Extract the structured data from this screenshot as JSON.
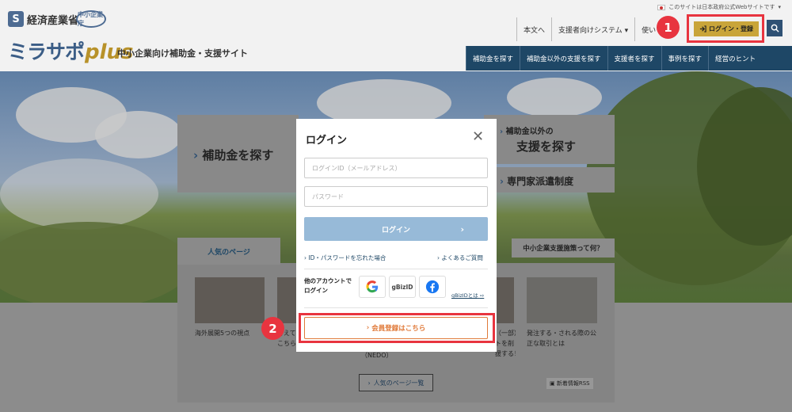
{
  "header": {
    "ministry_logo_mark": "S",
    "ministry_name": "経済産業省",
    "agency_badge": "中小企業庁",
    "brand_main": "ミラサポ",
    "brand_plus": "plus",
    "tagline": "中小企業向け補助金・支援サイト",
    "official_notice": "このサイトは日本政府公式Webサイトです",
    "official_notice_chevron": "▾",
    "top_links": [
      "本文へ",
      "支援者向けシステム ▾",
      "使い"
    ],
    "login_button_label": "ログイン・登録",
    "nav": [
      "補助金を探す",
      "補助金以外の支援を探す",
      "支援者を探す",
      "事例を探す",
      "経営のヒント"
    ]
  },
  "annotations": {
    "badge1": "1",
    "badge2": "2",
    "accent_color": "#e8343f"
  },
  "background_cards": {
    "subsidy": "補助金を探す",
    "other_support_line1": "補助金以外の",
    "other_support_line2": "支援を探す",
    "experts": "専門家派遣制度",
    "what_is": "中小企業支援施策って何？"
  },
  "popular": {
    "tab_label": "人気のページ",
    "items": [
      {
        "caption": "海外展開5つの視点"
      },
      {
        "caption": "考えて（一部）が変わった\nこちら"
      },
      {
        "caption": "（NEDO）"
      },
      {
        "caption": "（一部）で、\nトを削\n援する！"
      },
      {
        "caption": "発注する・される際の公\n正な取引とは"
      }
    ],
    "more_label": "人気のページ一覧",
    "rss_label": "新着情報RSS"
  },
  "modal": {
    "title": "ログイン",
    "close_label": "✕",
    "id_placeholder": "ログインID（メールアドレス）",
    "password_placeholder": "パスワード",
    "submit_label": "ログイン",
    "forgot_link": "ID・パスワードを忘れた場合",
    "faq_link": "よくあるご質問",
    "other_account_label": "他のアカウントで\nログイン",
    "gbiz_label": "gBizID",
    "gbiz_about": "gBizIDとは",
    "register_label": "会員登録はこちら"
  },
  "colors": {
    "brand_blue": "#3b5d86",
    "brand_gold": "#b8922a",
    "nav_bg": "#1e4766",
    "submit_bg": "#97bad8",
    "register_orange": "#e07a3a"
  }
}
